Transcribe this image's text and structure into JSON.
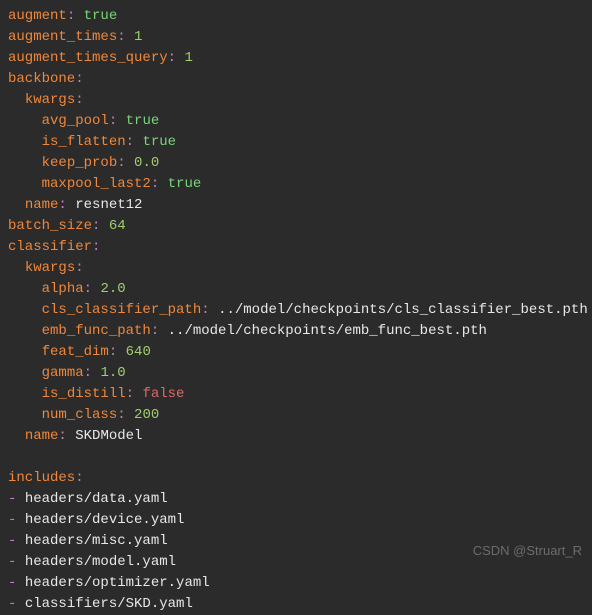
{
  "root": {
    "augment": {
      "key": "augment",
      "sep": ": ",
      "val": "true",
      "cls": "bool-true"
    },
    "augment_times": {
      "key": "augment_times",
      "sep": ": ",
      "val": "1",
      "cls": "num"
    },
    "augment_times_query": {
      "key": "augment_times_query",
      "sep": ": ",
      "val": "1",
      "cls": "num"
    },
    "backbone": {
      "key": "backbone",
      "sep": ":"
    },
    "bb_kwargs": {
      "key": "kwargs",
      "sep": ":"
    },
    "avg_pool": {
      "key": "avg_pool",
      "sep": ": ",
      "val": "true",
      "cls": "bool-true"
    },
    "is_flatten": {
      "key": "is_flatten",
      "sep": ": ",
      "val": "true",
      "cls": "bool-true"
    },
    "keep_prob": {
      "key": "keep_prob",
      "sep": ": ",
      "val": "0.0",
      "cls": "num"
    },
    "maxpool_last2": {
      "key": "maxpool_last2",
      "sep": ": ",
      "val": "true",
      "cls": "bool-true"
    },
    "bb_name": {
      "key": "name",
      "sep": ": ",
      "val": "resnet12",
      "cls": "str"
    },
    "batch_size": {
      "key": "batch_size",
      "sep": ": ",
      "val": "64",
      "cls": "num"
    },
    "classifier": {
      "key": "classifier",
      "sep": ":"
    },
    "cl_kwargs": {
      "key": "kwargs",
      "sep": ":"
    },
    "alpha": {
      "key": "alpha",
      "sep": ": ",
      "val": "2.0",
      "cls": "num"
    },
    "cls_classifier_path": {
      "key": "cls_classifier_path",
      "sep": ": ",
      "val": "../model/checkpoints/cls_classifier_best.pth",
      "cls": "str"
    },
    "emb_func_path": {
      "key": "emb_func_path",
      "sep": ": ",
      "val": "../model/checkpoints/emb_func_best.pth",
      "cls": "str"
    },
    "feat_dim": {
      "key": "feat_dim",
      "sep": ": ",
      "val": "640",
      "cls": "num"
    },
    "gamma": {
      "key": "gamma",
      "sep": ": ",
      "val": "1.0",
      "cls": "num"
    },
    "is_distill": {
      "key": "is_distill",
      "sep": ": ",
      "val": "false",
      "cls": "bool-false"
    },
    "num_class": {
      "key": "num_class",
      "sep": ": ",
      "val": "200",
      "cls": "num"
    },
    "cl_name": {
      "key": "name",
      "sep": ": ",
      "val": "SKDModel",
      "cls": "str"
    },
    "includes": {
      "key": "includes",
      "sep": ":"
    }
  },
  "includes_list": [
    "headers/data.yaml",
    "headers/device.yaml",
    "headers/misc.yaml",
    "headers/model.yaml",
    "headers/optimizer.yaml",
    "classifiers/SKD.yaml"
  ],
  "dash": "- ",
  "watermark": "CSDN @Struart_R"
}
